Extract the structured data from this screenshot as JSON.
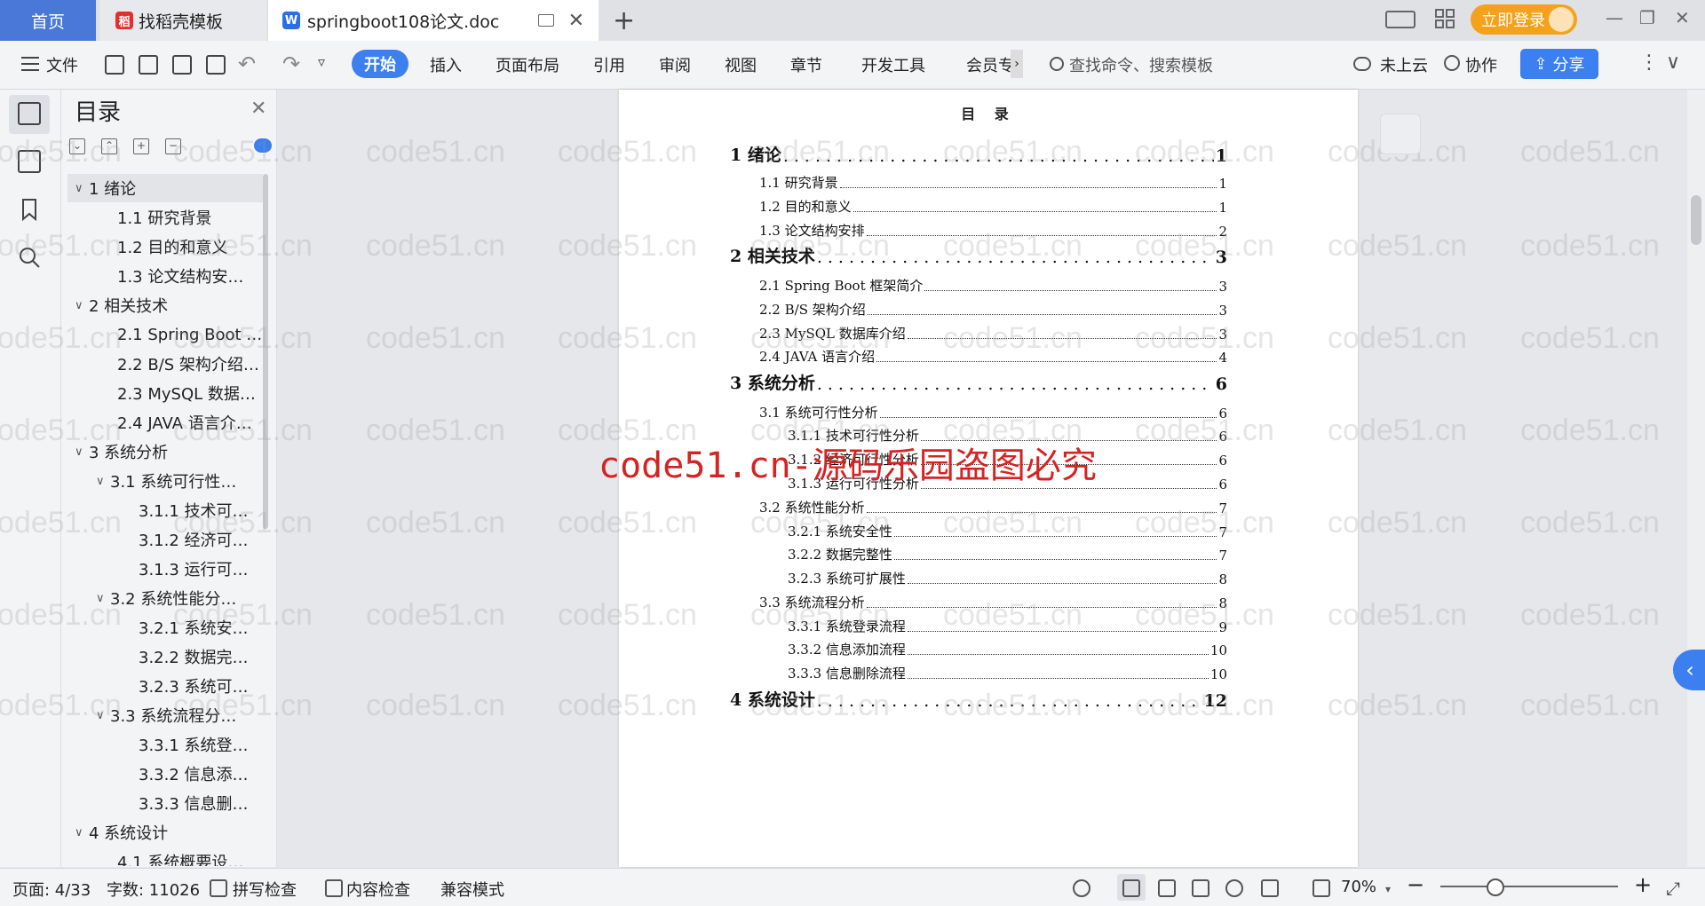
{
  "tabs": {
    "home": "首页",
    "template": "找稻壳模板",
    "document": "springboot108论文.doc",
    "login": "立即登录"
  },
  "toolbar": {
    "file": "文件",
    "items": [
      "开始",
      "插入",
      "页面布局",
      "引用",
      "审阅",
      "视图",
      "章节",
      "开发工具",
      "会员专"
    ],
    "search_placeholder": "查找命令、搜索模板",
    "cloud": "未上云",
    "collab": "协作",
    "share": "分享"
  },
  "nav": {
    "title": "目录",
    "items": [
      {
        "label": "1  绪论",
        "level": 1,
        "caret": "∨"
      },
      {
        "label": "1.1  研究背景",
        "level": 2,
        "caret": ""
      },
      {
        "label": "1.2 目的和意义",
        "level": 2,
        "caret": ""
      },
      {
        "label": "1.3  论文结构安…",
        "level": 2,
        "caret": ""
      },
      {
        "label": "2  相关技术",
        "level": 1,
        "caret": "∨"
      },
      {
        "label": "2.1 Spring Boot …",
        "level": 2,
        "caret": ""
      },
      {
        "label": "2.2 B/S 架构介绍…",
        "level": 2,
        "caret": ""
      },
      {
        "label": "2.3 MySQL 数据…",
        "level": 2,
        "caret": ""
      },
      {
        "label": "2.4 JAVA 语言介…",
        "level": 2,
        "caret": ""
      },
      {
        "label": "3  系统分析",
        "level": 1,
        "caret": "∨"
      },
      {
        "label": "3.1 系统可行性…",
        "level": 2,
        "caret": "∨"
      },
      {
        "label": "3.1.1  技术可…",
        "level": 3,
        "caret": ""
      },
      {
        "label": "3.1.2  经济可…",
        "level": 3,
        "caret": ""
      },
      {
        "label": "3.1.3  运行可…",
        "level": 3,
        "caret": ""
      },
      {
        "label": "3.2 系统性能分…",
        "level": 2,
        "caret": "∨"
      },
      {
        "label": "3.2.1  系统安…",
        "level": 3,
        "caret": ""
      },
      {
        "label": "3.2.2  数据完…",
        "level": 3,
        "caret": ""
      },
      {
        "label": "3.2.3 系统可…",
        "level": 3,
        "caret": ""
      },
      {
        "label": "3.3 系统流程分…",
        "level": 2,
        "caret": "∨"
      },
      {
        "label": "3.3.1 系统登…",
        "level": 3,
        "caret": ""
      },
      {
        "label": "3.3.2 信息添…",
        "level": 3,
        "caret": ""
      },
      {
        "label": "3.3.3 信息删…",
        "level": 3,
        "caret": ""
      },
      {
        "label": "4  系统设计",
        "level": 1,
        "caret": "∨"
      },
      {
        "label": "4.1 系统概要设…",
        "level": 2,
        "caret": ""
      }
    ]
  },
  "document": {
    "heading": "目 录",
    "toc": [
      {
        "text": "1  绪论",
        "page": "1",
        "level": 1
      },
      {
        "text": "1.1  研究背景",
        "page": "1",
        "level": 2
      },
      {
        "text": "1.2 目的和意义",
        "page": "1",
        "level": 2
      },
      {
        "text": "1.3  论文结构安排",
        "page": "2",
        "level": 2
      },
      {
        "text": "2  相关技术",
        "page": "3",
        "level": 1
      },
      {
        "text": "2.1 Spring Boot 框架简介",
        "page": "3",
        "level": 2
      },
      {
        "text": "2.2 B/S 架构介绍",
        "page": "3",
        "level": 2
      },
      {
        "text": "2.3 MySQL 数据库介绍",
        "page": "3",
        "level": 2
      },
      {
        "text": "2.4 JAVA 语言介绍",
        "page": "4",
        "level": 2
      },
      {
        "text": "3  系统分析",
        "page": "6",
        "level": 1
      },
      {
        "text": "3.1 系统可行性分析",
        "page": "6",
        "level": 2
      },
      {
        "text": "3.1.1  技术可行性分析",
        "page": "6",
        "level": 3
      },
      {
        "text": "3.1.2  经济可行性分析",
        "page": "6",
        "level": 3
      },
      {
        "text": "3.1.3  运行可行性分析",
        "page": "6",
        "level": 3
      },
      {
        "text": "3.2 系统性能分析",
        "page": "7",
        "level": 2
      },
      {
        "text": "3.2.1  系统安全性",
        "page": "7",
        "level": 3
      },
      {
        "text": "3.2.2  数据完整性",
        "page": "7",
        "level": 3
      },
      {
        "text": "3.2.3 系统可扩展性",
        "page": "8",
        "level": 3
      },
      {
        "text": "3.3 系统流程分析",
        "page": "8",
        "level": 2
      },
      {
        "text": "3.3.1 系统登录流程",
        "page": "9",
        "level": 3
      },
      {
        "text": "3.3.2 信息添加流程",
        "page": "10",
        "level": 3
      },
      {
        "text": "3.3.3 信息删除流程",
        "page": "10",
        "level": 3
      },
      {
        "text": "4  系统设计",
        "page": "12",
        "level": 1
      }
    ],
    "watermark": "code51.cn-源码乐园盗图必究",
    "tile_text": "code51.cn"
  },
  "status": {
    "page": "页面: 4/33",
    "words": "字数: 11026",
    "spell": "拼写检查",
    "content": "内容检查",
    "compat": "兼容模式",
    "zoom": "70%"
  },
  "colors": {
    "accent": "#3c7ff0",
    "login": "#f4a21b",
    "watermark": "#d52323"
  }
}
